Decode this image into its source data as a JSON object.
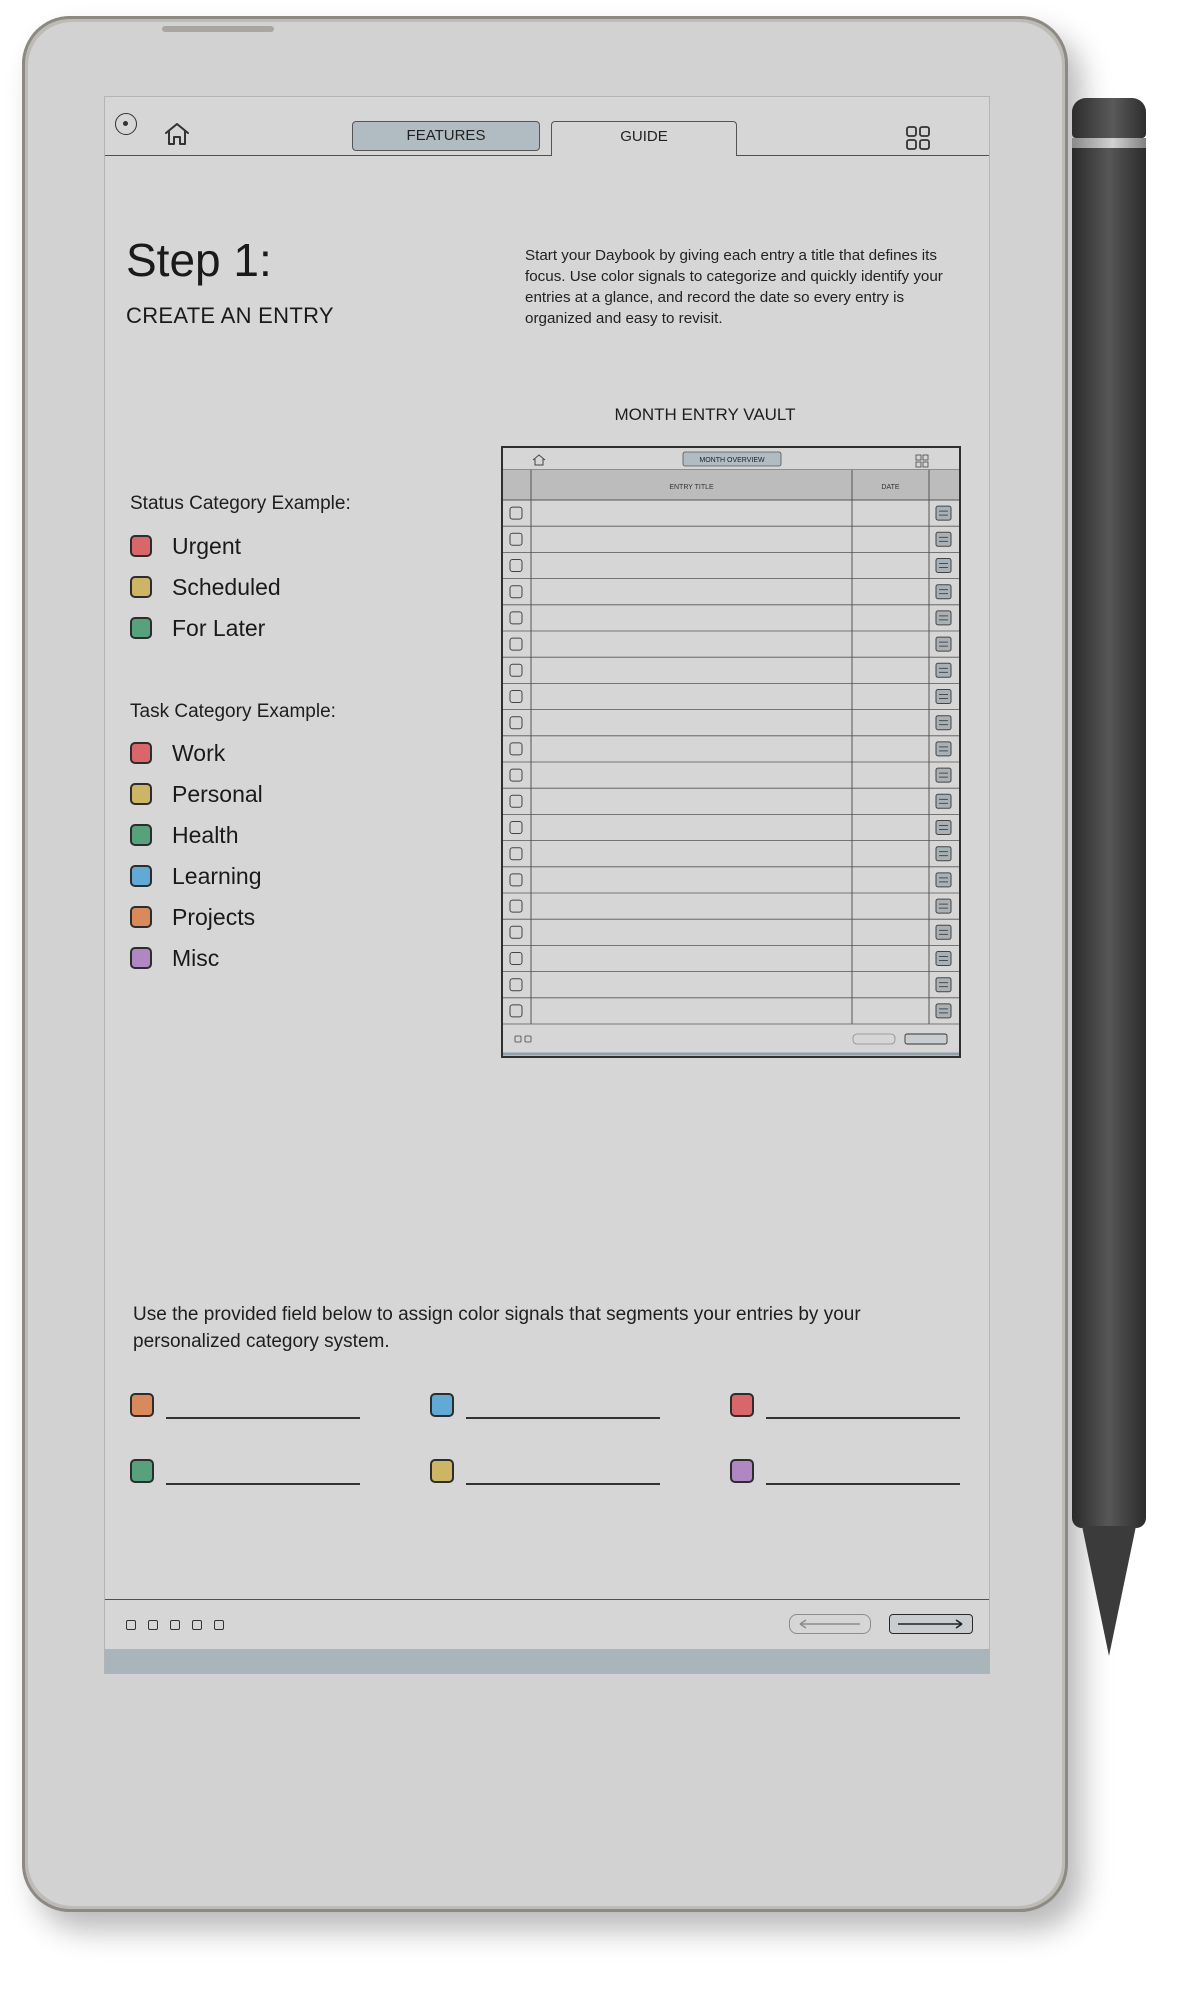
{
  "tabs": {
    "features": "FEATURES",
    "guide": "GUIDE"
  },
  "step": {
    "title": "Step 1:",
    "subtitle": "CREATE AN ENTRY",
    "description": "Start your Daybook by giving each entry a title that defines its focus. Use color signals to categorize and quickly identify your entries at a glance, and record the date so every entry is organized and easy to revisit."
  },
  "status_category": {
    "label": "Status Category Example:",
    "items": [
      {
        "label": "Urgent",
        "color": "#d9666b"
      },
      {
        "label": "Scheduled",
        "color": "#cdb565"
      },
      {
        "label": "For Later",
        "color": "#58a17d"
      }
    ]
  },
  "task_category": {
    "label": "Task Category Example:",
    "items": [
      {
        "label": "Work",
        "color": "#d9666b"
      },
      {
        "label": "Personal",
        "color": "#cdb565"
      },
      {
        "label": "Health",
        "color": "#58a17d"
      },
      {
        "label": "Learning",
        "color": "#63a9d6"
      },
      {
        "label": "Projects",
        "color": "#d98a5c"
      },
      {
        "label": "Misc",
        "color": "#b087c2"
      }
    ]
  },
  "vault": {
    "title": "MONTH ENTRY VAULT",
    "header_tab": "MONTH OVERVIEW",
    "col_title": "ENTRY TITLE",
    "col_date": "DATE",
    "row_count": 20
  },
  "assign": {
    "note": "Use the provided field below to assign color signals that segments your entries by your personalized category system.",
    "slots": [
      {
        "color": "#d98a5c"
      },
      {
        "color": "#63a9d6"
      },
      {
        "color": "#d9666b"
      },
      {
        "color": "#58a17d"
      },
      {
        "color": "#cdb565"
      },
      {
        "color": "#b087c2"
      }
    ]
  },
  "icons": {
    "top_left": "circle-dot-icon",
    "home": "home-icon",
    "grid": "grid-icon"
  }
}
